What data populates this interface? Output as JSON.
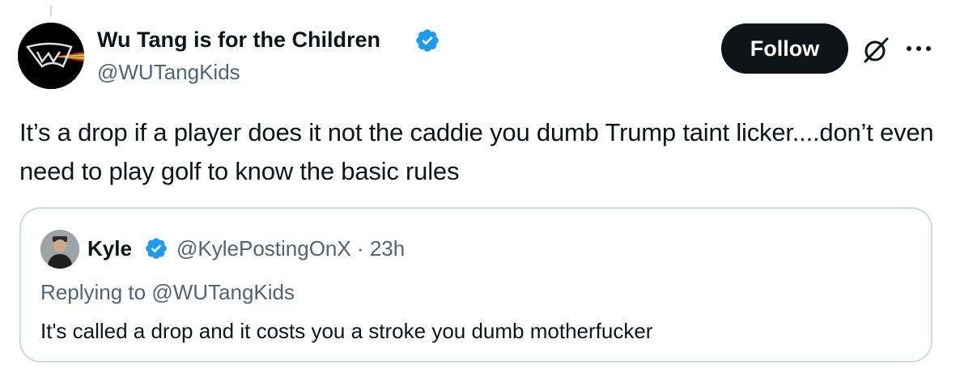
{
  "post": {
    "author_name": "Wu Tang is for the Children",
    "author_handle": "@WUTangKids",
    "follow_label": "Follow",
    "text": "It’s a drop if a player does it not the caddie you dumb Trump taint licker....don’t even need to play golf to know the basic rules"
  },
  "quoted_post": {
    "author_name": "Kyle",
    "author_handle": "@KylePostingOnX",
    "separator": " · ",
    "time": "23h",
    "replying_to_label": "Replying to ",
    "replying_to_handle": "@WUTangKids",
    "text": "It's called a drop and it costs you a stroke you dumb motherfucker"
  },
  "icons": {
    "verified": "verified-badge-icon",
    "grok": "grok-icon",
    "more": "more-options-icon"
  },
  "colors": {
    "verified": "#1d9bf0",
    "follow_bg": "#0f1419",
    "secondary_text": "#536471",
    "border": "#cfd9de"
  }
}
